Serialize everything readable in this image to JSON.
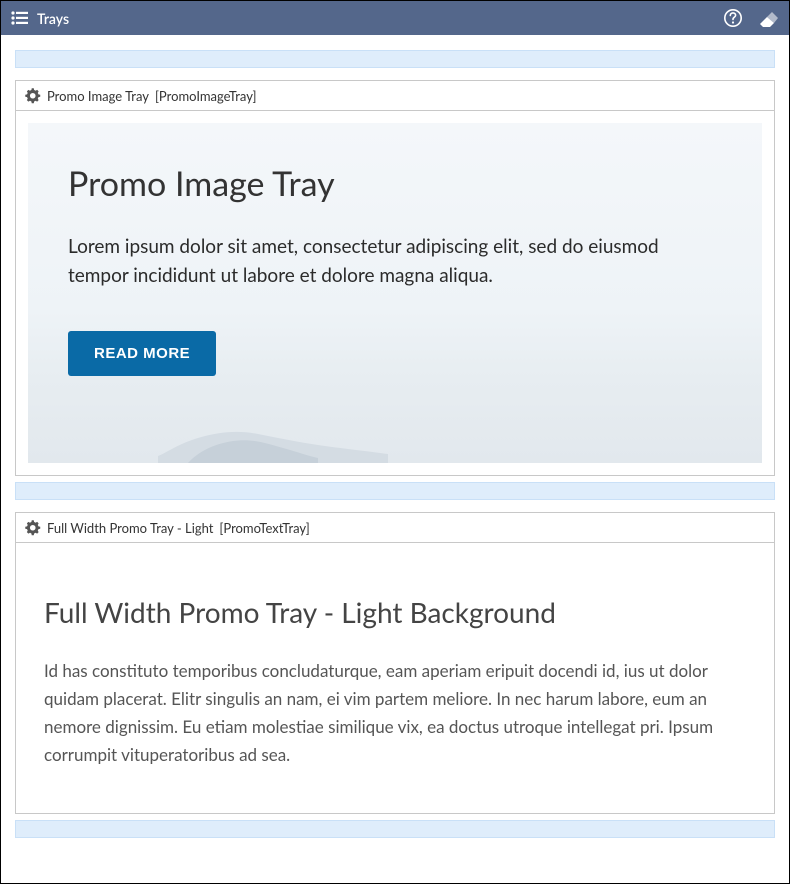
{
  "header": {
    "title": "Trays"
  },
  "trays": [
    {
      "label_title": "Promo Image Tray",
      "label_id": "[PromoImageTray]",
      "content": {
        "title": "Promo Image Tray",
        "body": "Lorem ipsum dolor sit amet, consectetur adipiscing elit, sed do eiusmod tempor incididunt ut labore et dolore magna aliqua.",
        "cta": "READ MORE"
      }
    },
    {
      "label_title": "Full Width Promo Tray - Light",
      "label_id": "[PromoTextTray]",
      "content": {
        "title": "Full Width Promo Tray - Light Background",
        "body": "Id has constituto temporibus concludaturque, eam aperiam eripuit docendi id, ius ut dolor quidam placerat. Elitr singulis an nam, ei vim partem meliore. In nec harum labore, eum an nemore dignissim. Eu etiam molestiae similique vix, ea doctus utroque intellegat pri. Ipsum corrumpit vituperatoribus ad sea."
      }
    }
  ]
}
